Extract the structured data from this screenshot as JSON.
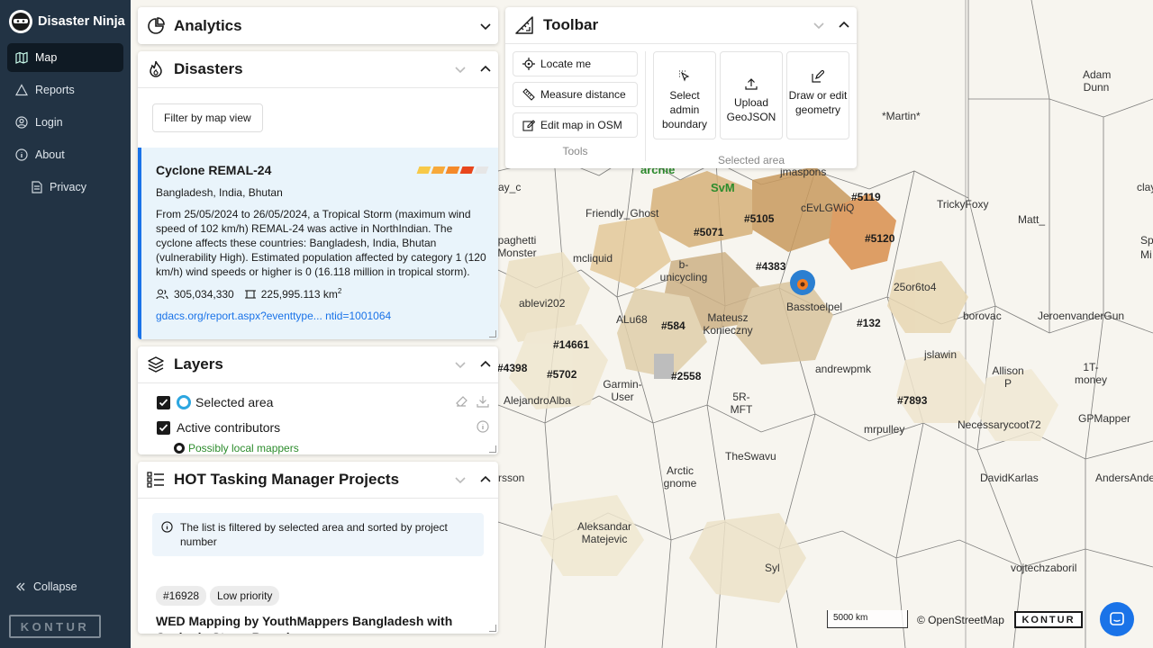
{
  "app": {
    "title": "Disaster Ninja"
  },
  "sidebar": {
    "items": [
      {
        "label": "Map",
        "icon": "map-icon",
        "active": true
      },
      {
        "label": "Reports",
        "icon": "reports-icon"
      },
      {
        "label": "Login",
        "icon": "user-icon"
      },
      {
        "label": "About",
        "icon": "info-icon"
      },
      {
        "label": "Privacy",
        "icon": "document-icon"
      }
    ],
    "collapse_label": "Collapse",
    "logo_text": "KONTUR"
  },
  "analytics": {
    "title": "Analytics"
  },
  "disasters": {
    "title": "Disasters",
    "filter_label": "Filter by map view",
    "event": {
      "name": "Cyclone REMAL-24",
      "countries": "Bangladesh, India, Bhutan",
      "description": "From 25/05/2024 to 26/05/2024, a Tropical Storm (maximum wind speed of 102 km/h) REMAL-24 was active in NorthIndian. The cyclone affects these countries: Bangladesh, India, Bhutan (vulnerability High). Estimated population affected by category 1 (120 km/h) wind speeds or higher is 0 (16.118 million in tropical storm).",
      "population": "305,034,330",
      "area": "225,995.113 km",
      "area_sup": "2",
      "link": "gdacs.org/report.aspx?eventtype... ntid=1001064",
      "severity_colors": [
        "#f7c948",
        "#f7a93a",
        "#f58a2a",
        "#e8461c",
        "#e6e6e6"
      ]
    }
  },
  "layers": {
    "title": "Layers",
    "items": [
      {
        "label": "Selected area",
        "checked": true
      },
      {
        "label": "Active contributors",
        "checked": true
      }
    ],
    "legend": "Possibly local mappers"
  },
  "hot": {
    "title": "HOT Tasking Manager Projects",
    "info": "The list is filtered by selected area and sorted by project number",
    "project": {
      "id": "#16928",
      "priority": "Low priority",
      "title": "WED Mapping by YouthMappers Bangladesh with Cyclonic Storm Remal"
    }
  },
  "toolbar": {
    "title": "Toolbar",
    "tools": [
      "Locate me",
      "Measure distance",
      "Edit map in OSM"
    ],
    "tools_caption": "Tools",
    "area_buttons": [
      "Select admin boundary",
      "Upload GeoJSON",
      "Draw or edit geometry"
    ],
    "area_caption": "Selected area"
  },
  "map": {
    "labels": [
      {
        "text": "archie",
        "style": "green"
      },
      {
        "text": "SvM",
        "style": "green"
      },
      {
        "text": "jmaspons"
      },
      {
        "text": "#5119",
        "style": "hash"
      },
      {
        "text": "*Martin*"
      },
      {
        "text": "Adam Dunn"
      },
      {
        "text": "Friendly_Ghost"
      },
      {
        "text": "#5105",
        "style": "hash"
      },
      {
        "text": "cEvLGWiQ"
      },
      {
        "text": "TrickyFoxy"
      },
      {
        "text": "Matt_"
      },
      {
        "text": "#5071",
        "style": "hash"
      },
      {
        "text": "#5120",
        "style": "hash"
      },
      {
        "text": "paghetti Monster"
      },
      {
        "text": "mcliquid"
      },
      {
        "text": "b-unicycling"
      },
      {
        "text": "#4383",
        "style": "hash"
      },
      {
        "text": "25or6to4"
      },
      {
        "text": "ablevi202"
      },
      {
        "text": "ALu68"
      },
      {
        "text": "#584",
        "style": "hash"
      },
      {
        "text": "Mateusz Konieczny"
      },
      {
        "text": "Basstoelpel"
      },
      {
        "text": "#132",
        "style": "hash"
      },
      {
        "text": "borovac"
      },
      {
        "text": "JeroenvanderGun"
      },
      {
        "text": "#14661",
        "style": "hash"
      },
      {
        "text": "jslawin"
      },
      {
        "text": "#4398",
        "style": "hash"
      },
      {
        "text": "#5702",
        "style": "hash"
      },
      {
        "text": "#2558",
        "style": "hash"
      },
      {
        "text": "andrewpmk"
      },
      {
        "text": "Allison P"
      },
      {
        "text": "1T-money"
      },
      {
        "text": "AlejandroAlba"
      },
      {
        "text": "Garmin-User"
      },
      {
        "text": "5R-MFT"
      },
      {
        "text": "#7893",
        "style": "hash"
      },
      {
        "text": "Necessarycoot72"
      },
      {
        "text": "GPMapper"
      },
      {
        "text": "mrpulley"
      },
      {
        "text": "TheSwavu"
      },
      {
        "text": "Arctic gnome"
      },
      {
        "text": "DavidKarlas"
      },
      {
        "text": "AndersAnders"
      },
      {
        "text": "rsson"
      },
      {
        "text": "Aleksandar Matejevic"
      },
      {
        "text": "Syl"
      },
      {
        "text": "vojtechzaboril"
      },
      {
        "text": "ay_c"
      },
      {
        "text": "clay"
      },
      {
        "text": "Sp"
      },
      {
        "text": "Mi"
      }
    ],
    "scale_label": "5000 km",
    "attribution": "© OpenStreetMap",
    "logo_text": "KONTUR"
  },
  "colors": {
    "sidebar": "#223344",
    "accent": "#1a73e8",
    "link": "#1a73e8",
    "green": "#2c8c2c"
  }
}
